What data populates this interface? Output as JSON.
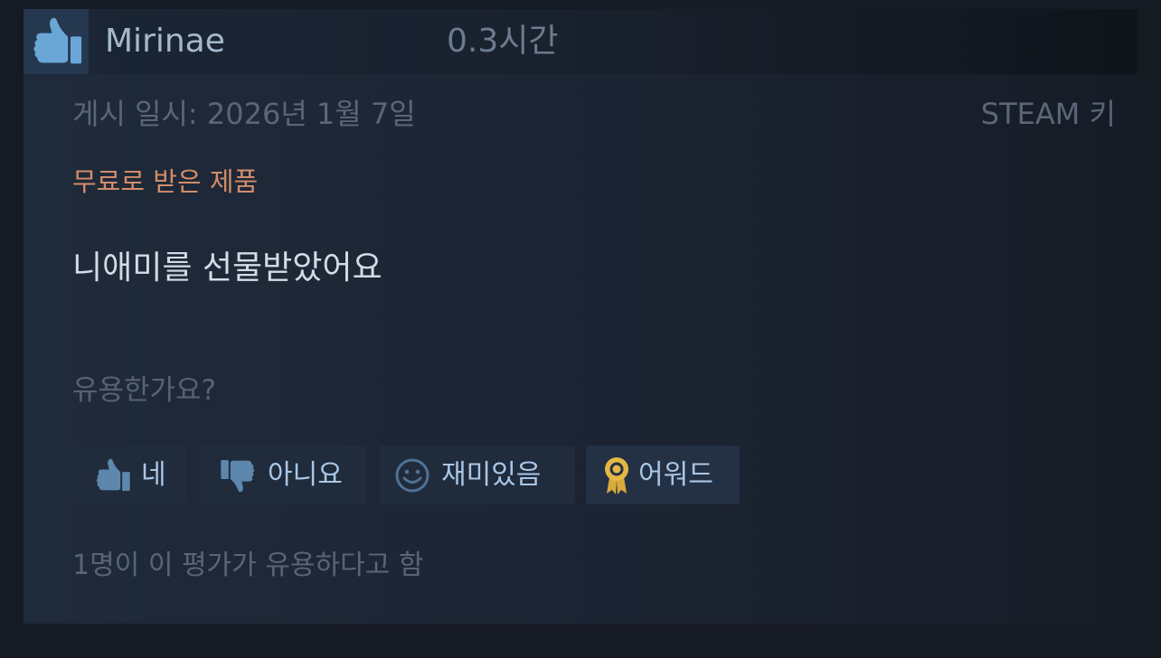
{
  "review": {
    "reviewer_name": "Mirinae",
    "playtime": "0.3시간",
    "recommendation_icon": "thumbs-up-icon",
    "posted_date": "게시 일시: 2026년 1월 7일",
    "key_source": "STEAM 키",
    "free_product_label": "무료로 받은 제품",
    "text": "니애미를 선물받았어요",
    "helpful_question": "유용한가요?",
    "helpful_count": "1명이 이 평가가 유용하다고 함"
  },
  "buttons": {
    "yes": {
      "label": "네",
      "icon": "thumbs-up-icon"
    },
    "no": {
      "label": "아니요",
      "icon": "thumbs-down-icon"
    },
    "funny": {
      "label": "재미있음",
      "icon": "smiley-icon"
    },
    "award": {
      "label": "어워드",
      "icon": "award-ribbon-icon"
    }
  },
  "colors": {
    "background": "#161a23",
    "card": "#1e2838",
    "thumb_box": "#25384f",
    "thumb_icon": "#6aa6d6",
    "button": "#202b3b",
    "button_text": "#a9c7e6",
    "free_product": "#d38c69",
    "award_gold": "#e4b746"
  }
}
